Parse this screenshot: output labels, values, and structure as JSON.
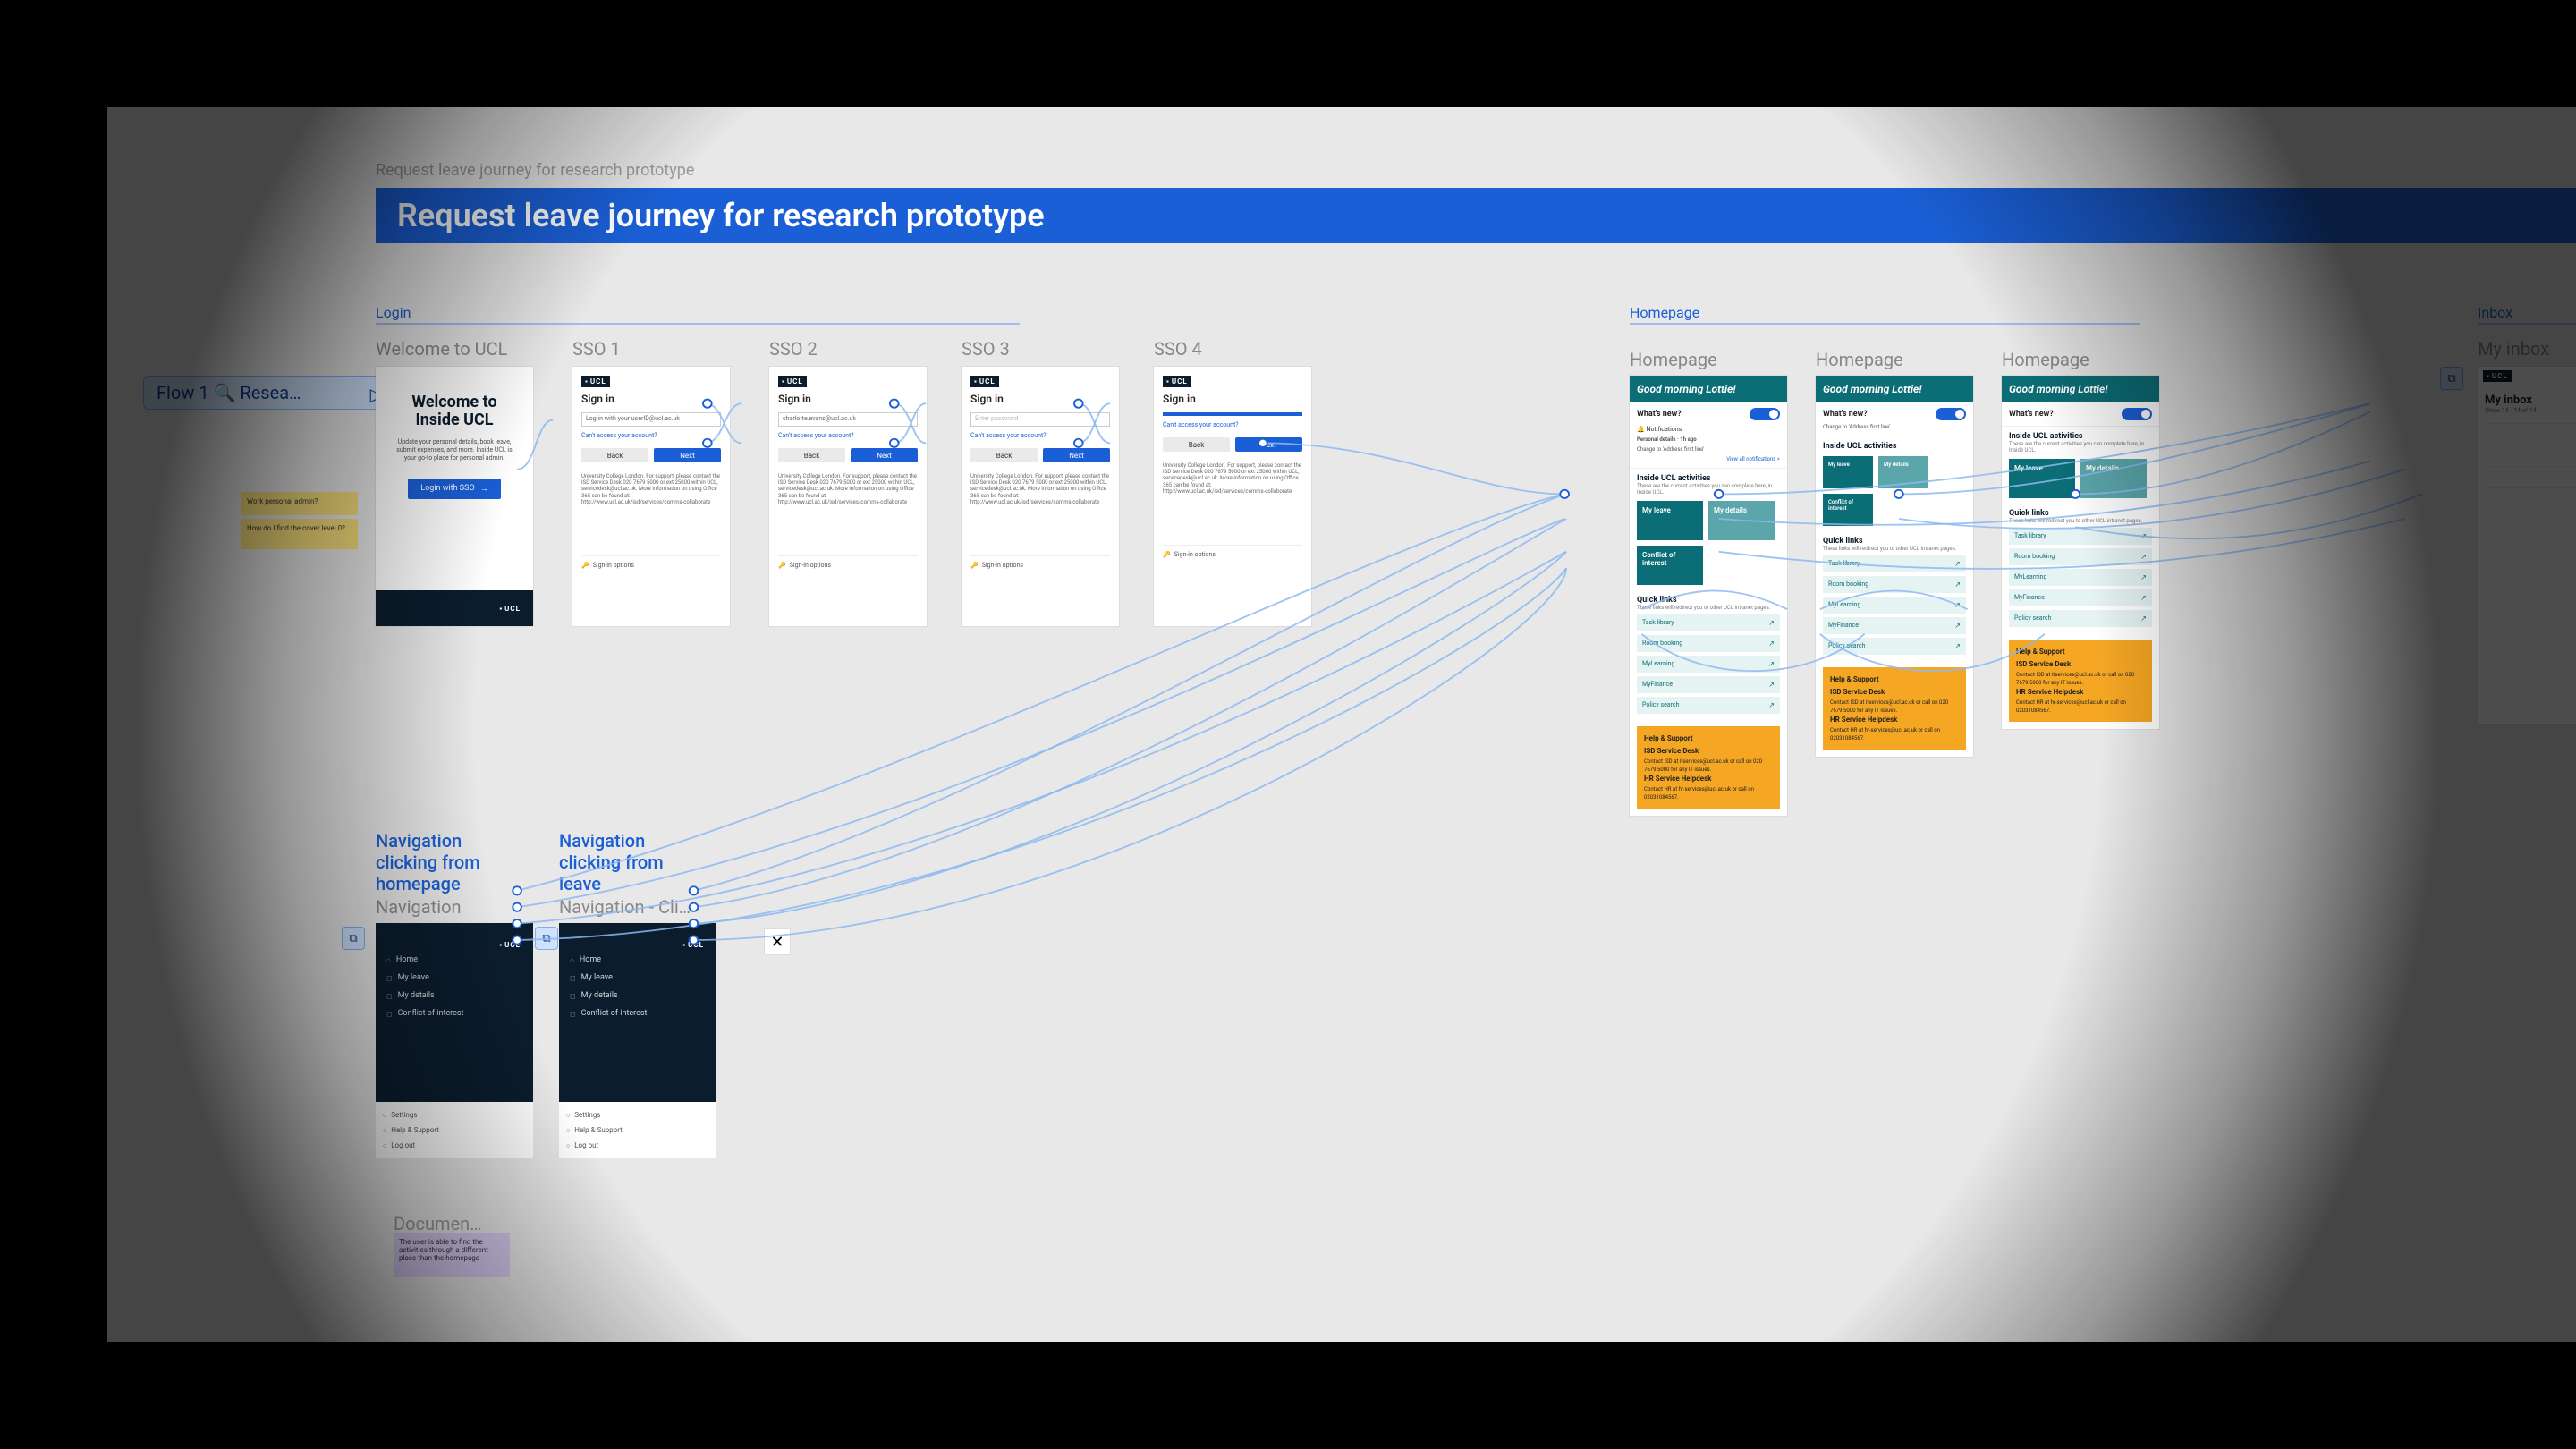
{
  "breadcrumb": "Request leave journey for research prototype",
  "page_title": "Request leave journey for research prototype",
  "flow_pill": "Flow 1 🔍 Resea…",
  "sections": {
    "login": "Login",
    "homepage": "Homepage",
    "inbox": "Inbox"
  },
  "stickies": {
    "note1": "Work personal admin?",
    "note2": "How do I find the cover level 0?",
    "doc_note_title": "Documen…",
    "doc_note_body": "The user is able to find the activities through a different place than the homepage"
  },
  "frames": {
    "welcome": {
      "label": "Welcome to UCL",
      "title": "Welcome to Inside UCL",
      "subtitle": "Update your personal details, book leave, submit expenses, and more. Inside UCL is your go-to place for personal admin.",
      "button": "Login with SSO",
      "footer_logo": "UCL"
    },
    "sso1": {
      "label": "SSO 1",
      "heading": "Sign in",
      "field_placeholder": "Log in with your userID@ucl.ac.uk",
      "link": "Can't access your account?",
      "back": "Back",
      "next": "Next",
      "help": "University College London. For support, please contact the ISD Service Desk 020 7679 5000 or ext 25000 within UCL, servicedesk@ucl.ac.uk. More information on using Office 365 can be found at: http://www.ucl.ac.uk/isd/services/comms-collaborate",
      "signin_options": "Sign-in options"
    },
    "sso2": {
      "label": "SSO 2",
      "field_value": "charlotte.evans@ucl.ac.uk"
    },
    "sso3": {
      "label": "SSO 3",
      "field_placeholder": "Enter password"
    },
    "sso4": {
      "label": "SSO 4"
    },
    "nav_label_a": "Navigation clicking from homepage",
    "nav_label_b": "Navigation clicking from leave",
    "nav_a_title": "Navigation",
    "nav_b_title": "Navigation - Cli…",
    "nav_items": [
      "Home",
      "My leave",
      "My details",
      "Conflict of interest"
    ],
    "nav_bottom": [
      "Settings",
      "Help & Support",
      "Log out"
    ],
    "homepage": {
      "label": "Homepage",
      "greeting": "Good morning Lottie!",
      "whats_new": "What's new?",
      "notifications_label": "🔔 Notifications",
      "notif_item_title": "Personal details · 1h ago",
      "notif_item_body": "Change to ‘Address first line’",
      "view_all": "View all notifications >",
      "activities_title": "Inside UCL activities",
      "activities_sub": "These are the current activities you can complete here, in Inside UCL.",
      "tiles": [
        "My leave",
        "My details",
        "Conflict of interest"
      ],
      "quick_links_title": "Quick links",
      "quick_links_sub": "These links will redirect you to other UCL intranet pages.",
      "quick_links": [
        "Task library",
        "Room booking",
        "MyLearning",
        "MyFinance",
        "Policy search"
      ],
      "support": {
        "heading": "Help & Support",
        "isd_title": "ISD Service Desk",
        "isd_body": "Contact ISD at itservices@ucl.ac.uk or call on 020 7679 5000 for any IT issues.",
        "hr_title": "HR Service Helpdesk",
        "hr_body": "Contact HR at hr-services@ucl.ac.uk or call on 02031084567."
      }
    },
    "inbox": {
      "label": "My inbox",
      "title": "My inbox",
      "meta": "Show 14 · 14 of 14"
    }
  },
  "brand": {
    "logo_text": "UCL"
  }
}
